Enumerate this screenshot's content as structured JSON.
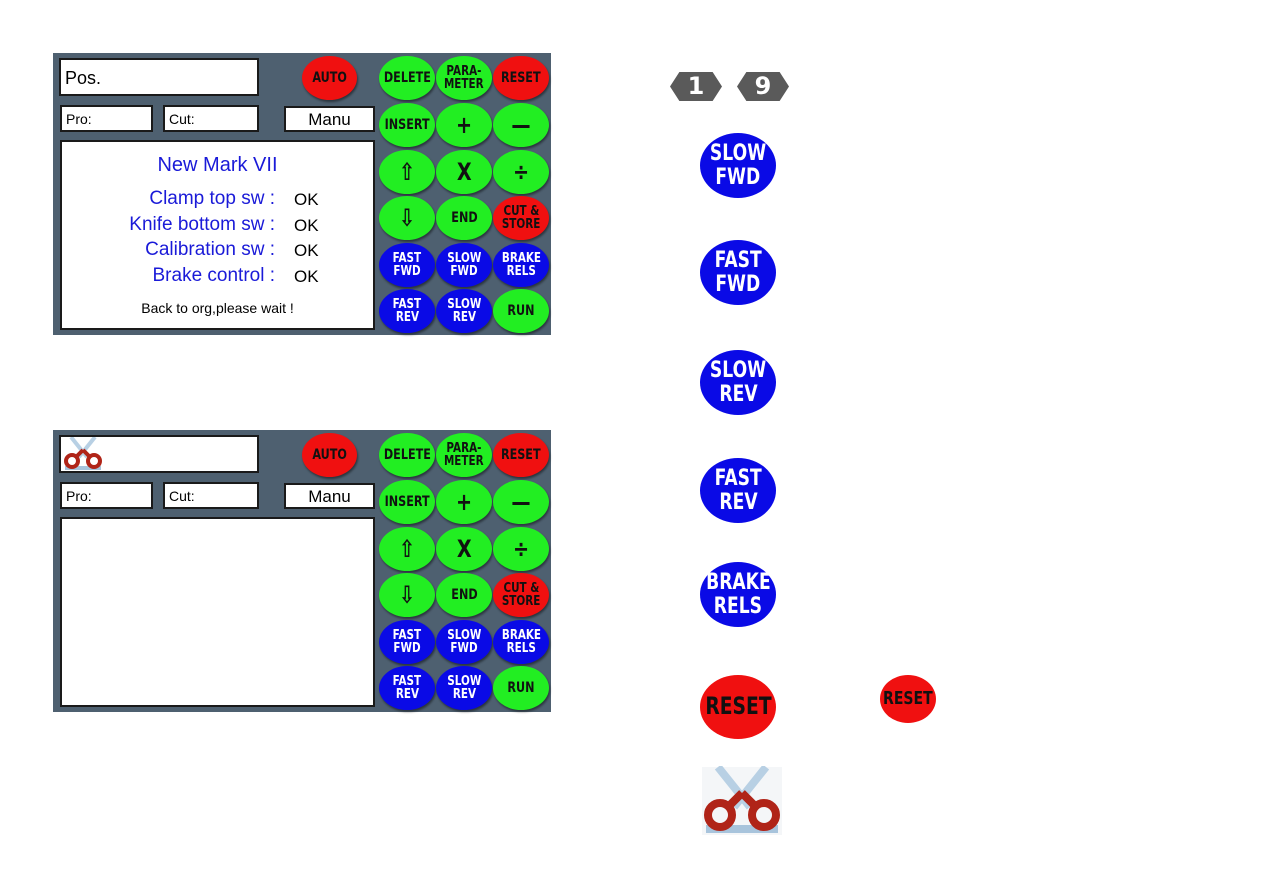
{
  "colors": {
    "panel_bg": "#4e6070",
    "green": "#22ee22",
    "red": "#f01010",
    "blue": "#0a0ae6",
    "label_blue": "#1a1ad8"
  },
  "panel1": {
    "pos_label": "Pos.",
    "pro_label": "Pro:",
    "cut_label": "Cut:",
    "mode": "Manu",
    "title": "New Mark VII",
    "checks": [
      {
        "label": "Clamp top sw :",
        "value": "OK"
      },
      {
        "label": "Knife bottom sw :",
        "value": "OK"
      },
      {
        "label": "Calibration sw :",
        "value": "OK"
      },
      {
        "label": "Brake control :",
        "value": "OK"
      }
    ],
    "message": "Back to org,please wait !"
  },
  "panel2": {
    "pos_icon": "scissors-icon",
    "pro_label": "Pro:",
    "cut_label": "Cut:",
    "mode": "Manu"
  },
  "keypad": {
    "auto": "AUTO",
    "buttons": [
      {
        "id": "delete",
        "lines": [
          "DELETE"
        ],
        "color": "g"
      },
      {
        "id": "parameter",
        "lines": [
          "PARA-",
          "METER"
        ],
        "color": "g"
      },
      {
        "id": "reset",
        "lines": [
          "RESET"
        ],
        "color": "r"
      },
      {
        "id": "insert",
        "lines": [
          "INSERT"
        ],
        "color": "g"
      },
      {
        "id": "plus",
        "lines": [
          "+"
        ],
        "color": "g"
      },
      {
        "id": "minus",
        "lines": [
          "—"
        ],
        "color": "g"
      },
      {
        "id": "up-arrow",
        "lines": [
          "⇧"
        ],
        "color": "g"
      },
      {
        "id": "multiply",
        "lines": [
          "X"
        ],
        "color": "g"
      },
      {
        "id": "divide",
        "lines": [
          "÷"
        ],
        "color": "g"
      },
      {
        "id": "down-arrow",
        "lines": [
          "⇩"
        ],
        "color": "g"
      },
      {
        "id": "end",
        "lines": [
          "END"
        ],
        "color": "g"
      },
      {
        "id": "cut-store",
        "lines": [
          "CUT &",
          "STORE"
        ],
        "color": "r"
      },
      {
        "id": "fast-fwd",
        "lines": [
          "FAST",
          "FWD"
        ],
        "color": "b"
      },
      {
        "id": "slow-fwd",
        "lines": [
          "SLOW",
          "FWD"
        ],
        "color": "b"
      },
      {
        "id": "brake-rels",
        "lines": [
          "BRAKE",
          "RELS"
        ],
        "color": "b"
      },
      {
        "id": "fast-rev",
        "lines": [
          "FAST",
          "REV"
        ],
        "color": "b"
      },
      {
        "id": "slow-rev",
        "lines": [
          "SLOW",
          "REV"
        ],
        "color": "b"
      },
      {
        "id": "run",
        "lines": [
          "RUN"
        ],
        "color": "g"
      }
    ]
  },
  "legend": {
    "badges": [
      "1",
      "9"
    ],
    "icons": [
      {
        "id": "slow-fwd",
        "lines": [
          "SLOW",
          "FWD"
        ]
      },
      {
        "id": "fast-fwd",
        "lines": [
          "FAST",
          "FWD"
        ]
      },
      {
        "id": "slow-rev",
        "lines": [
          "SLOW",
          "REV"
        ]
      },
      {
        "id": "fast-rev",
        "lines": [
          "FAST",
          "REV"
        ]
      },
      {
        "id": "brake-rels",
        "lines": [
          "BRAKE",
          "RELS"
        ]
      }
    ],
    "reset_large": "RESET",
    "reset_small": "RESET",
    "scissors": "scissors-icon"
  }
}
